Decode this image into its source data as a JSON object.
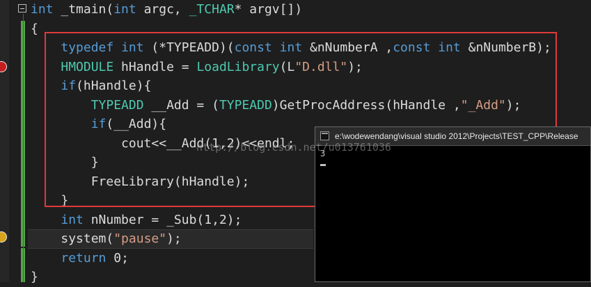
{
  "editor": {
    "lines": [
      {
        "indent": "",
        "parts": [
          {
            "t": "int",
            "c": "kw"
          },
          {
            "t": " _tmain(",
            "c": "fn"
          },
          {
            "t": "int",
            "c": "kw"
          },
          {
            "t": " argc, ",
            "c": "fn"
          },
          {
            "t": "_TCHAR",
            "c": "ty"
          },
          {
            "t": "* argv[])",
            "c": "fn"
          }
        ]
      },
      {
        "indent": "",
        "parts": [
          {
            "t": "{",
            "c": "fn"
          }
        ]
      },
      {
        "indent": "    ",
        "parts": [
          {
            "t": "typedef",
            "c": "kw"
          },
          {
            "t": " ",
            "c": "fn"
          },
          {
            "t": "int",
            "c": "kw"
          },
          {
            "t": " (*TYPEADD)(",
            "c": "fn"
          },
          {
            "t": "const",
            "c": "kw"
          },
          {
            "t": " ",
            "c": "fn"
          },
          {
            "t": "int",
            "c": "kw"
          },
          {
            "t": " &nNumberA ,",
            "c": "fn"
          },
          {
            "t": "const",
            "c": "kw"
          },
          {
            "t": " ",
            "c": "fn"
          },
          {
            "t": "int",
            "c": "kw"
          },
          {
            "t": " &nNumberB);",
            "c": "fn"
          }
        ]
      },
      {
        "indent": "    ",
        "parts": [
          {
            "t": "HMODULE",
            "c": "ty"
          },
          {
            "t": " hHandle = ",
            "c": "fn"
          },
          {
            "t": "LoadLibrary",
            "c": "ty"
          },
          {
            "t": "(L",
            "c": "fn"
          },
          {
            "t": "\"D.dll\"",
            "c": "str"
          },
          {
            "t": ");",
            "c": "fn"
          }
        ]
      },
      {
        "indent": "    ",
        "parts": [
          {
            "t": "if",
            "c": "kw"
          },
          {
            "t": "(hHandle){",
            "c": "fn"
          }
        ]
      },
      {
        "indent": "        ",
        "parts": [
          {
            "t": "TYPEADD",
            "c": "ty"
          },
          {
            "t": " __Add = (",
            "c": "fn"
          },
          {
            "t": "TYPEADD",
            "c": "ty"
          },
          {
            "t": ")GetProcAddress(hHandle ,",
            "c": "fn"
          },
          {
            "t": "\"_Add\"",
            "c": "str"
          },
          {
            "t": ");",
            "c": "fn"
          }
        ]
      },
      {
        "indent": "        ",
        "parts": [
          {
            "t": "if",
            "c": "kw"
          },
          {
            "t": "(__Add){",
            "c": "fn"
          }
        ]
      },
      {
        "indent": "            ",
        "parts": [
          {
            "t": "cout<<__Add(1,2)<<endl;",
            "c": "fn"
          }
        ]
      },
      {
        "indent": "        ",
        "parts": [
          {
            "t": "}",
            "c": "fn"
          }
        ]
      },
      {
        "indent": "        ",
        "parts": [
          {
            "t": "FreeLibrary(hHandle);",
            "c": "fn"
          }
        ]
      },
      {
        "indent": "    ",
        "parts": [
          {
            "t": "}",
            "c": "fn"
          }
        ]
      },
      {
        "indent": "    ",
        "parts": [
          {
            "t": "int",
            "c": "kw"
          },
          {
            "t": " nNumber = _Sub(1,2);",
            "c": "fn"
          }
        ]
      },
      {
        "indent": "    ",
        "parts": [
          {
            "t": "system(",
            "c": "fn"
          },
          {
            "t": "\"pause\"",
            "c": "str"
          },
          {
            "t": ");",
            "c": "fn"
          }
        ]
      },
      {
        "indent": "    ",
        "parts": [
          {
            "t": "return",
            "c": "kw"
          },
          {
            "t": " 0;",
            "c": "fn"
          }
        ]
      },
      {
        "indent": "",
        "parts": [
          {
            "t": "}",
            "c": "fn"
          }
        ]
      }
    ]
  },
  "console": {
    "title": "e:\\wodewendang\\visual studio 2012\\Projects\\TEST_CPP\\Release",
    "output": "3"
  },
  "watermark": "http://blog.csdn.net/u013761036",
  "colors": {
    "keyword": "#569cd6",
    "type": "#4ec9b0",
    "string": "#d69d85",
    "highlight_box": "#e03a3a",
    "change_bar": "#57a64a"
  }
}
